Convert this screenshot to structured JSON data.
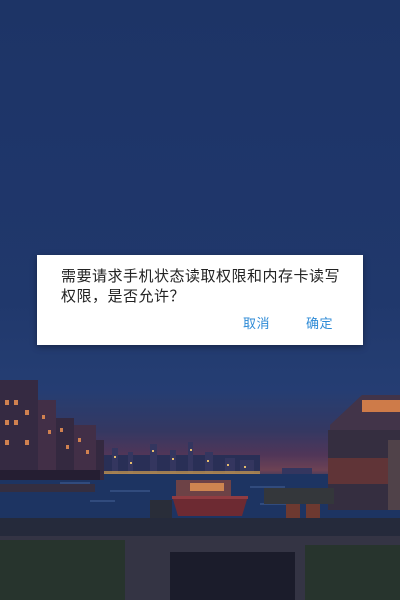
{
  "dialog": {
    "message": "需要请求手机状态读取权限和内存卡读写权限，是否允许？",
    "cancel_label": "取消",
    "confirm_label": "确定"
  },
  "colors": {
    "sky": "#243f79",
    "accent": "#2d8ad6",
    "dialog_bg": "#ffffff",
    "text": "#222222"
  }
}
